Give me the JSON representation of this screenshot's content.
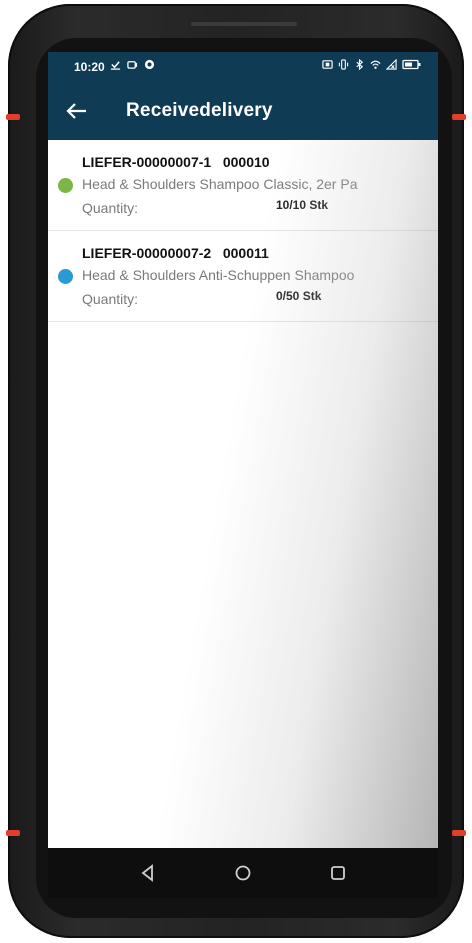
{
  "status_bar": {
    "time": "10:20"
  },
  "app_bar": {
    "title": "Receivedelivery"
  },
  "deliveries": [
    {
      "id": "LIEFER-00000007-1",
      "code": "000010",
      "description": "Head & Shoulders Shampoo Classic, 2er Pa",
      "quantity_label": "Quantity:",
      "quantity_value": "10/10 Stk",
      "status_color": "#7ab648"
    },
    {
      "id": "LIEFER-00000007-2",
      "code": "000011",
      "description": "Head & Shoulders Anti-Schuppen Shampoo",
      "quantity_label": "Quantity:",
      "quantity_value": "0/50 Stk",
      "status_color": "#2a9ad6"
    }
  ],
  "colors": {
    "header": "#0f3b55",
    "accent": "#e0402a"
  }
}
